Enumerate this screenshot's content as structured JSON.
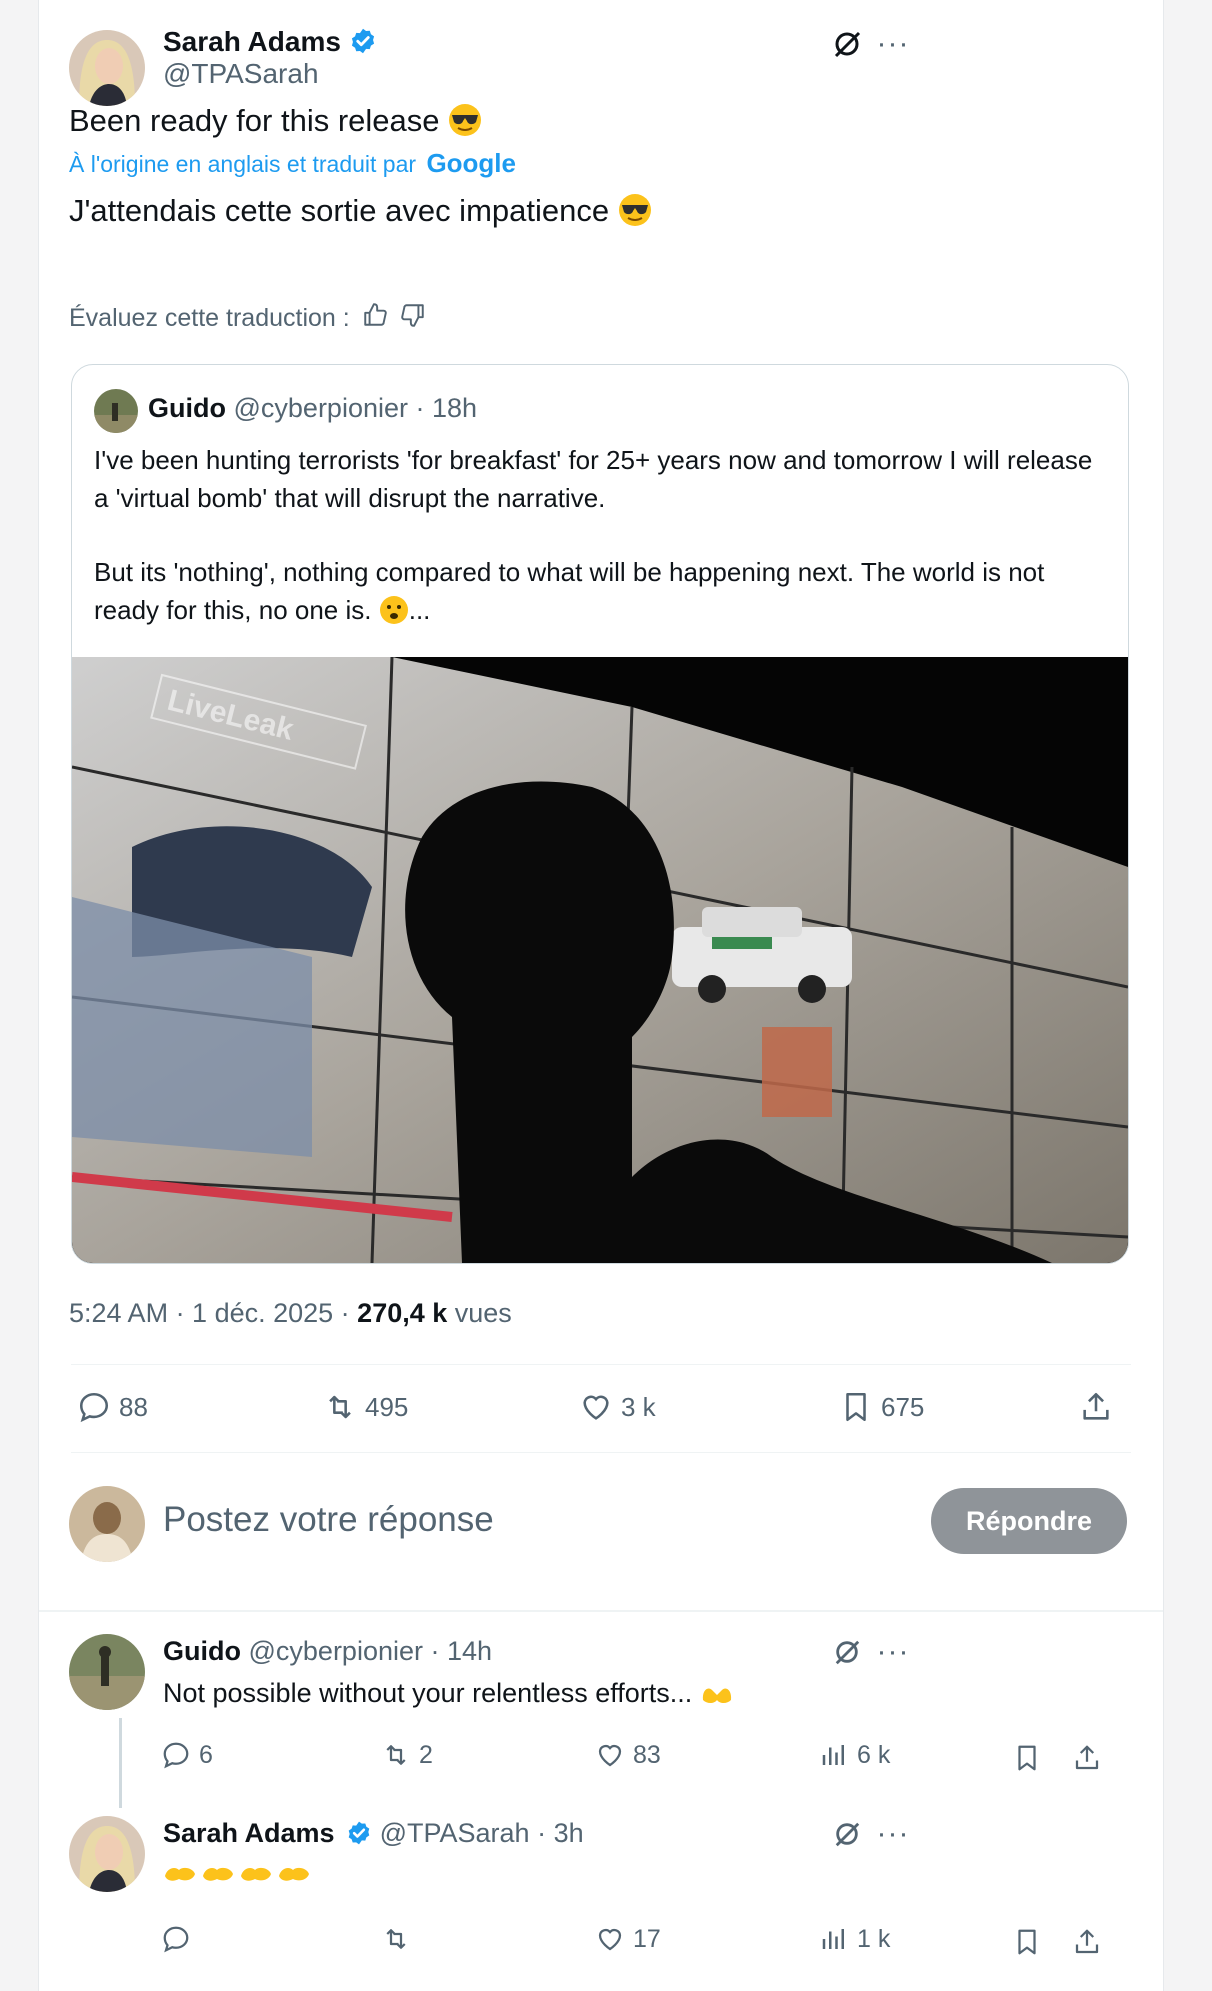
{
  "tweet": {
    "author_name": "Sarah Adams",
    "author_handle": "@TPASarah",
    "text": "Been ready for this release",
    "translation_note": "À l'origine en anglais et traduit par",
    "translation_brand": "Google",
    "translated_text": "J'attendais cette sortie avec impatience",
    "rate_translation": "Évaluez cette traduction :",
    "timestamp": "5:24 AM · 1 déc. 2025 · ",
    "views_count": "270,4 k",
    "views_label": " vues"
  },
  "quote": {
    "author_name": "Guido",
    "author_handle": "@cyberpionier · 18h",
    "para1": "I've been hunting terrorists 'for breakfast' for 25+ years now and tomorrow I will release a 'virtual bomb' that will disrupt the narrative.",
    "para2": "But its 'nothing', nothing compared to what will be happening next. The world is not ready for this, no one is.",
    "ellipsis": "...",
    "media_watermark": "LiveLeak"
  },
  "actions": {
    "replies": "88",
    "reposts": "495",
    "likes": "3 k",
    "bookmarks": "675"
  },
  "reply_box": {
    "placeholder": "Postez votre réponse",
    "button": "Répondre"
  },
  "replies": [
    {
      "author_name": "Guido",
      "author_handle": "@cyberpionier · 14h",
      "text": "Not possible without your relentless efforts...",
      "replies": "6",
      "reposts": "2",
      "likes": "83",
      "views": "6 k"
    },
    {
      "author_name": "Sarah Adams",
      "author_handle": "@TPASarah · 3h",
      "text": "",
      "replies": "",
      "reposts": "",
      "likes": "17",
      "views": "1 k"
    }
  ],
  "colors": {
    "accent": "#1d9bf0",
    "muted": "#536471",
    "button_disabled": "#8f9499",
    "emoji_yellow": "#fcc21b"
  }
}
